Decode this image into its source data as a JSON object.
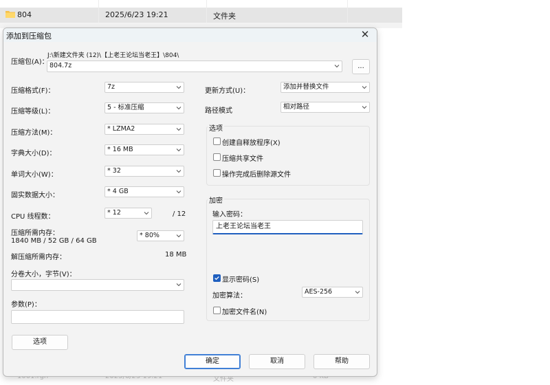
{
  "explorer": {
    "row": {
      "name": "804",
      "date": "2025/6/23 19:21",
      "type": "文件夹"
    },
    "ghost_row": {
      "name": "1001.rgh",
      "date": "2025/6/23 19:21",
      "type": "文件夹",
      "size": "0 KB"
    }
  },
  "dialog": {
    "title": "添加到压缩包",
    "archive": {
      "label": "压缩包(A)：",
      "path": "J:\\新建文件夹 (12)\\【上老王论坛当老王】\\804\\",
      "value": "804.7z",
      "browse_label": "..."
    },
    "left": {
      "format": {
        "label": "压缩格式(F)：",
        "value": "7z"
      },
      "level": {
        "label": "压缩等级(L)：",
        "value": "5 - 标准压缩"
      },
      "method": {
        "label": "压缩方法(M)：",
        "value": "*  LZMA2"
      },
      "dict": {
        "label": "字典大小(D)：",
        "value": "*  16 MB"
      },
      "word": {
        "label": "单词大小(W)：",
        "value": "*  32"
      },
      "solid": {
        "label": "固实数据大小：",
        "value": "*  4 GB"
      },
      "threads": {
        "label": "CPU 线程数：",
        "value": "*  12",
        "max": "/ 12"
      },
      "memory": {
        "label": "压缩所需内存：",
        "detail": "1840 MB / 52 GB / 64 GB",
        "value": "*  80%"
      },
      "decompress": {
        "label": "解压缩所需内存：",
        "value": "18 MB"
      },
      "split": {
        "label": "分卷大小，字节(V)：",
        "value": ""
      },
      "params": {
        "label": "参数(P)：",
        "value": ""
      },
      "options_button": "选项"
    },
    "right": {
      "update": {
        "label": "更新方式(U)：",
        "value": "添加并替换文件"
      },
      "pathmode": {
        "label": "路径模式",
        "value": "相对路径"
      },
      "options_group": {
        "title": "选项",
        "sfx": "创建自释放程序(X)",
        "shared": "压缩共享文件",
        "delete": "操作完成后删除源文件"
      },
      "encryption": {
        "title": "加密",
        "password_label": "输入密码：",
        "password": "上老王论坛当老王",
        "show_password": "显示密码(S)",
        "method_label": "加密算法：",
        "method": "AES-256",
        "encrypt_names": "加密文件名(N)"
      }
    },
    "buttons": {
      "ok": "确定",
      "cancel": "取消",
      "help": "帮助"
    }
  },
  "colors": {
    "accent": "#1f5fbf",
    "folder": "#f5c04a"
  }
}
